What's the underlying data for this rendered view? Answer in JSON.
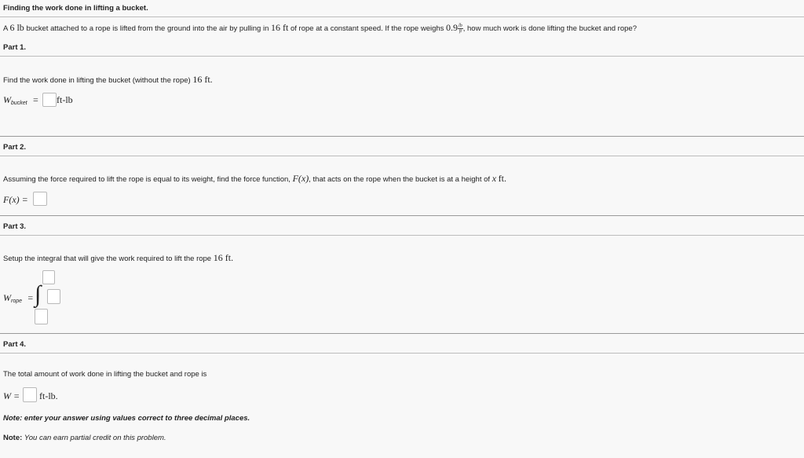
{
  "header": {
    "title": "Finding the work done in lifting a bucket."
  },
  "problem": {
    "p1": "A",
    "weight": "6 lb",
    "p2": "bucket attached to a rope is lifted from the ground into the air by pulling in",
    "length": "16 ft",
    "p3": "of rope at a constant speed. If the rope weighs",
    "rope_weight": "0.9",
    "frac_num": "lb",
    "frac_den": "ft",
    "p4": ", how much work is done lifting the bucket and rope?"
  },
  "part1": {
    "label": "Part 1.",
    "question": "Find the work done in lifting the bucket (without the rope)",
    "question_value": "16 ft.",
    "var": "W",
    "var_sub": "bucket",
    "equals": "=",
    "unit": "ft-lb"
  },
  "part2": {
    "label": "Part 2.",
    "q1": "Assuming the force required to lift the rope is equal to its weight, find the force function,",
    "func": "F(x)",
    "q2": ", that acts on the rope when the bucket is at a height of",
    "var_x": "x",
    "unit": "ft.",
    "answer_lhs": "F(x) ="
  },
  "part3": {
    "label": "Part 3.",
    "question": "Setup the integral that will give the work required to lift the rope",
    "question_value": "16 ft.",
    "var": "W",
    "var_sub": "rope",
    "equals": "=",
    "integral_sign": "∫"
  },
  "part4": {
    "label": "Part 4.",
    "question": "The total amount of work done in lifting the bucket and rope is",
    "lhs": "W =",
    "unit": "ft-lb."
  },
  "notes": {
    "note1_label": "Note:",
    "note1_text": "enter your answer using values correct to three decimal places.",
    "note2_label": "Note:",
    "note2_text": "You can earn partial credit on this problem."
  }
}
